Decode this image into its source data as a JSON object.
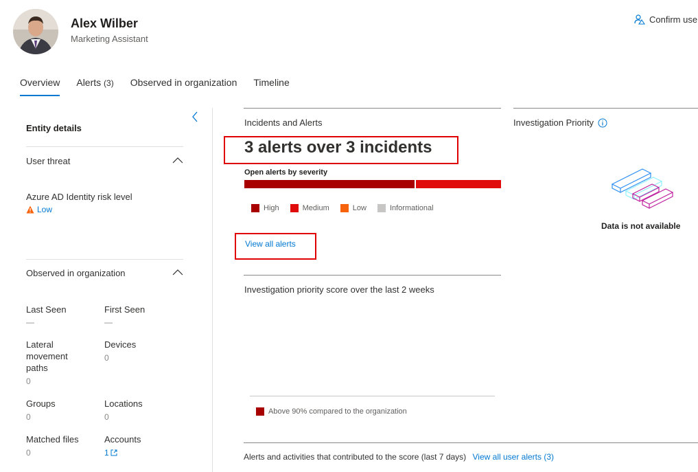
{
  "header": {
    "name": "Alex Wilber",
    "job_title": "Marketing Assistant",
    "confirm_label": "Confirm user"
  },
  "tabs": [
    {
      "label": "Overview",
      "count": ""
    },
    {
      "label": "Alerts",
      "count": "(3)"
    },
    {
      "label": "Observed in organization",
      "count": ""
    },
    {
      "label": "Timeline",
      "count": ""
    }
  ],
  "left": {
    "entity_details": "Entity details",
    "user_threat": "User threat",
    "risk_label": "Azure AD Identity risk level",
    "risk_value": "Low",
    "observed": "Observed in organization",
    "stats": {
      "last_seen": {
        "label": "Last Seen",
        "value": "—"
      },
      "first_seen": {
        "label": "First Seen",
        "value": "—"
      },
      "lateral": {
        "label1": "Lateral",
        "label2": "movement",
        "label3": "paths",
        "value": "0"
      },
      "devices": {
        "label": "Devices",
        "value": "0"
      },
      "groups": {
        "label": "Groups",
        "value": "0"
      },
      "locations": {
        "label": "Locations",
        "value": "0"
      },
      "matched_files": {
        "label": "Matched files",
        "value": "0"
      },
      "accounts": {
        "label": "Accounts",
        "value": "1"
      }
    }
  },
  "incidents": {
    "title": "Incidents and Alerts",
    "headline": "3 alerts over 3 incidents",
    "severity_label": "Open alerts by severity",
    "severity_bar": [
      {
        "name": "High",
        "fraction": 0.667,
        "color": "#a80000"
      },
      {
        "name": "Medium",
        "fraction": 0.333,
        "color": "#e00b0b"
      }
    ],
    "legend": [
      {
        "name": "High",
        "color": "#a80000"
      },
      {
        "name": "Medium",
        "color": "#e00b0b"
      },
      {
        "name": "Low",
        "color": "#f7630c"
      },
      {
        "name": "Informational",
        "color": "#c8c6c4"
      }
    ],
    "view_all": "View all alerts"
  },
  "priority": {
    "title": "Investigation Priority",
    "not_available": "Data is not available",
    "chart_title": "Investigation priority score over the last 2 weeks",
    "chart_legend": "Above 90% compared to the organization",
    "chart_legend_color": "#a80000"
  },
  "contrib": {
    "text": "Alerts and activities that contributed to the score (last 7 days)",
    "link": "View all user alerts (3)"
  },
  "colors": {
    "accent": "#0078d4",
    "warning": "#f7630c",
    "highlight_box": "#e00000"
  }
}
